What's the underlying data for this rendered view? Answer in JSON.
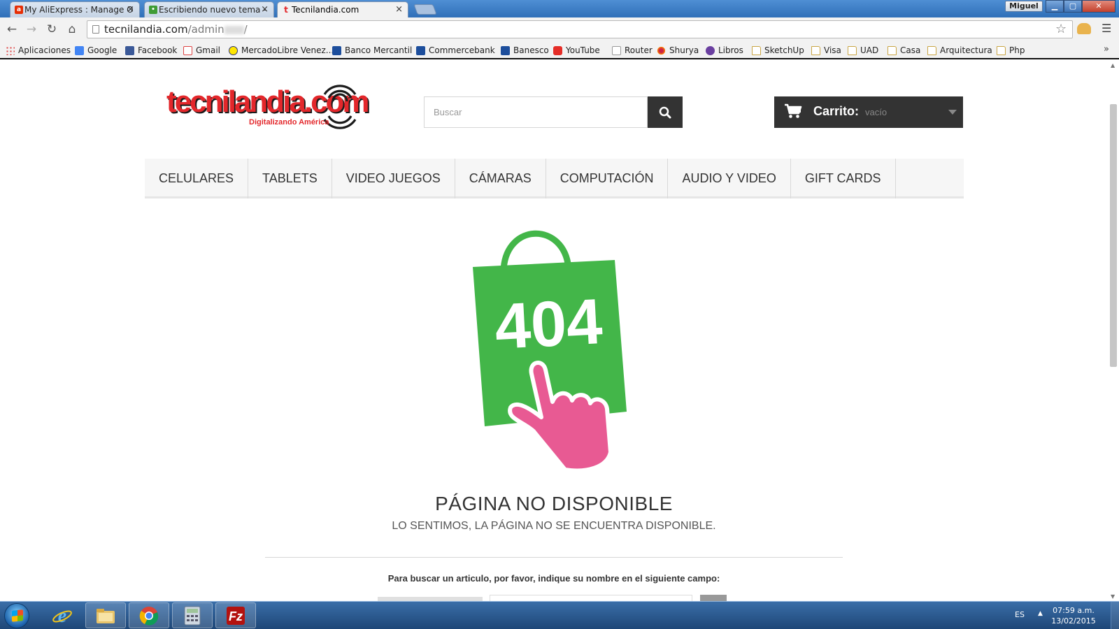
{
  "browser": {
    "tabs": [
      {
        "title": "My AliExpress : Manage O",
        "active": false,
        "favicon": "aliexpress-icon"
      },
      {
        "title": "Escribiendo nuevo tema -",
        "active": false,
        "favicon": "forum-icon"
      },
      {
        "title": "Tecnilandia.com",
        "active": true,
        "favicon": "tecnilandia-icon"
      }
    ],
    "profile_name": "Miguel",
    "url": {
      "host": "tecnilandia.com",
      "path_start": "/admin",
      "path_end": "/"
    },
    "bookmarks": [
      {
        "label": "Aplicaciones",
        "icon": "apps-icon"
      },
      {
        "label": "Google",
        "icon": "google-icon"
      },
      {
        "label": "Facebook",
        "icon": "facebook-icon"
      },
      {
        "label": "Gmail",
        "icon": "gmail-icon"
      },
      {
        "label": "MercadoLibre Venez...",
        "icon": "mercadolibre-icon"
      },
      {
        "label": "Banco Mercantil",
        "icon": "bank-icon"
      },
      {
        "label": "Commercebank",
        "icon": "bank-icon"
      },
      {
        "label": "Banesco",
        "icon": "bank-icon"
      },
      {
        "label": "YouTube",
        "icon": "youtube-icon"
      },
      {
        "label": "Router",
        "icon": "page-icon"
      },
      {
        "label": "Shurya",
        "icon": "shurya-icon"
      },
      {
        "label": "Libros",
        "icon": "books-icon"
      },
      {
        "label": "SketchUp",
        "icon": "folder-icon"
      },
      {
        "label": "Visa",
        "icon": "folder-icon"
      },
      {
        "label": "UAD",
        "icon": "folder-icon"
      },
      {
        "label": "Casa",
        "icon": "folder-icon"
      },
      {
        "label": "Arquitectura",
        "icon": "folder-icon"
      },
      {
        "label": "Php",
        "icon": "folder-icon"
      }
    ],
    "more_bookmarks": "»"
  },
  "site": {
    "logo": {
      "text": "tecnilandia.com",
      "tagline": "Digitalizando América"
    },
    "search": {
      "placeholder": "Buscar"
    },
    "cart": {
      "label": "Carrito:",
      "state": "vacío"
    },
    "menu": [
      "CELULARES",
      "TABLETS",
      "VIDEO JUEGOS",
      "CÁMARAS",
      "COMPUTACIÓN",
      "AUDIO Y VIDEO",
      "GIFT CARDS"
    ],
    "error": {
      "code": "404",
      "title": "PÁGINA NO DISPONIBLE",
      "subtitle": "LO SENTIMOS, LA PÁGINA NO SE ENCUENTRA DISPONIBLE.",
      "hint": "Para buscar un articulo, por favor, indique su nombre en el siguiente campo:"
    },
    "colors": {
      "brand_red": "#e3272b",
      "bag_green": "#43b649",
      "hand_pink": "#e85a93",
      "dark": "#333333"
    }
  },
  "taskbar": {
    "apps": [
      "internet-explorer-icon",
      "file-explorer-icon",
      "chrome-icon",
      "calculator-icon",
      "filezilla-icon"
    ],
    "language": "ES",
    "time": "07:59 a.m.",
    "date": "13/02/2015"
  }
}
